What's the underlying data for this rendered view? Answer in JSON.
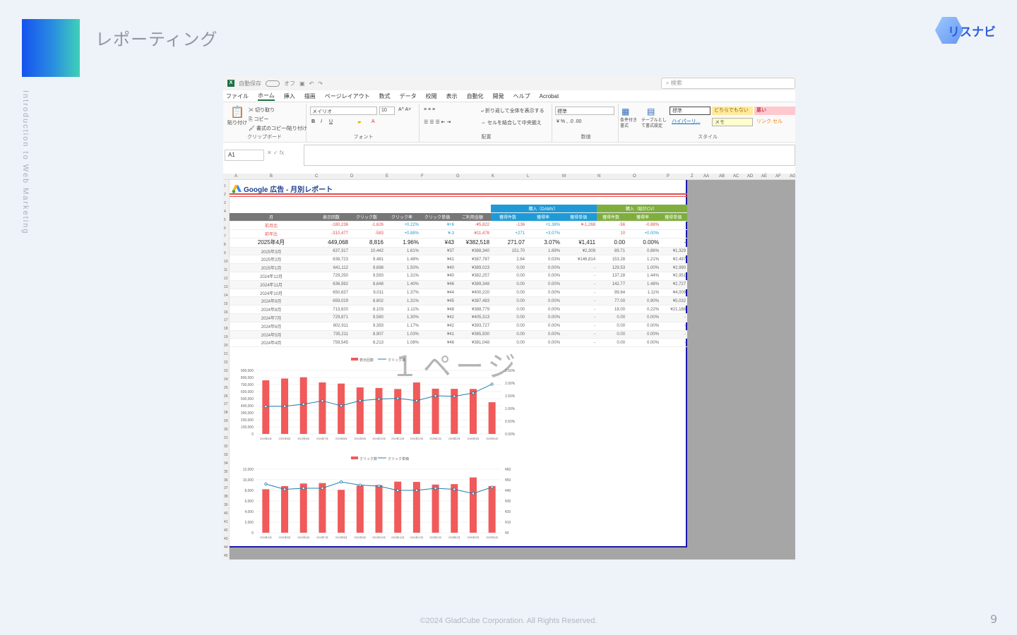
{
  "slide": {
    "title": "レポーティング",
    "side_text": "Introduction to Web Marketing",
    "logo_text": "リスナビ",
    "footer": "©2024 GladCube Corporation. All Rights Reserved.",
    "page_number": "9"
  },
  "excel": {
    "autosave_label": "自動保存",
    "autosave_state": "オフ",
    "search_placeholder": "検索",
    "menu": [
      "ファイル",
      "ホーム",
      "挿入",
      "描画",
      "ページレイアウト",
      "数式",
      "データ",
      "校閲",
      "表示",
      "自動化",
      "開発",
      "ヘルプ",
      "Acrobat"
    ],
    "ribbon": {
      "clipboard": {
        "label": "クリップボード",
        "paste": "貼り付け",
        "cut": "切り取り",
        "copy": "コピー",
        "format_painter": "書式のコピー/貼り付け"
      },
      "font": {
        "label": "フォント",
        "name": "メイリオ",
        "size": "10"
      },
      "alignment": {
        "label": "配置",
        "wrap": "折り返して全体を表示する",
        "merge": "セルを結合して中央揃え"
      },
      "number": {
        "label": "数値",
        "format": "標準"
      },
      "styles": {
        "label": "スタイル",
        "conditional": "条件付き書式",
        "table": "テーブルとして書式設定",
        "standard": "標準",
        "neutral": "どちらでもない",
        "bad": "悪い",
        "hyperlink": "ハイパーリ...",
        "memo": "メモ",
        "link_cell": "リンク セル"
      }
    },
    "name_box": "A1",
    "columns": [
      "A",
      "B",
      "C",
      "D",
      "E",
      "F",
      "G",
      "K",
      "L",
      "M",
      "N",
      "O",
      "P",
      "Z",
      "AA",
      "AB",
      "AC",
      "AD",
      "AE",
      "AF",
      "AG"
    ],
    "rows": [
      "1",
      "2",
      "3",
      "4",
      "5",
      "6",
      "7",
      "8",
      "9",
      "10",
      "11",
      "12",
      "13",
      "14",
      "15",
      "16",
      "17",
      "18",
      "19",
      "20",
      "21",
      "22",
      "23",
      "24",
      "25",
      "26",
      "27",
      "28",
      "29",
      "30",
      "31",
      "32",
      "33",
      "34",
      "35",
      "36",
      "37",
      "38",
      "39",
      "40",
      "41",
      "42",
      "43",
      "44",
      "45",
      "46",
      "47",
      "48",
      "49",
      "50"
    ],
    "watermark": "１ページ"
  },
  "report": {
    "title": "Google 広告 - 月別レポート",
    "group1": "購入（DAMV）",
    "group2": "購入（総計CV）",
    "headers": [
      "月",
      "表示回数",
      "クリック数",
      "クリック率",
      "クリック単価",
      "ご利用金額",
      "獲得件数",
      "獲得率",
      "獲得単価",
      "獲得件数",
      "獲得率",
      "獲得単価"
    ],
    "rows": [
      {
        "type": "sub",
        "cells": [
          "前月比",
          "-180,236",
          "-1,626",
          "+0.22%",
          "¥+6",
          "-¥5,822",
          "-136",
          "+1.38%",
          "¥-1,268",
          "-56",
          "-0.88%",
          ""
        ]
      },
      {
        "type": "sub",
        "cells": [
          "前年比",
          "-310,477",
          "-583",
          "+0.88%",
          "¥-3",
          "-¥11,478",
          "+271",
          "+3.07%",
          "",
          "10",
          "+0.00%",
          ""
        ]
      },
      {
        "type": "main",
        "cells": [
          "2025年4月",
          "449,068",
          "8,816",
          "1.96%",
          "¥43",
          "¥382,518",
          "271.07",
          "3.07%",
          "¥1,411",
          "0.00",
          "0.00%",
          "-"
        ]
      },
      {
        "type": "row",
        "cells": [
          "2025年3月",
          "637,317",
          "10,442",
          "1.61%",
          "¥37",
          "¥388,340",
          "151.70",
          "1.69%",
          "¥2,309",
          "89.71",
          "0.86%",
          "¥1,329"
        ]
      },
      {
        "type": "row",
        "cells": [
          "2025年2月",
          "638,723",
          "9,481",
          "1.48%",
          "¥41",
          "¥387,787",
          "2.64",
          "0.03%",
          "¥146,814",
          "153.28",
          "1.21%",
          "¥2,497"
        ]
      },
      {
        "type": "row",
        "cells": [
          "2025年1月",
          "641,112",
          "9,698",
          "1.50%",
          "¥40",
          "¥389,023",
          "0.00",
          "0.00%",
          "-",
          "129.53",
          "1.00%",
          "¥2,990"
        ]
      },
      {
        "type": "row",
        "cells": [
          "2024年12月",
          "729,250",
          "9,593",
          "1.31%",
          "¥40",
          "¥382,257",
          "0.00",
          "0.00%",
          "-",
          "137.28",
          "1.44%",
          "¥2,951"
        ]
      },
      {
        "type": "row",
        "cells": [
          "2024年11月",
          "636,592",
          "8,648",
          "1.40%",
          "¥46",
          "¥389,348",
          "0.00",
          "0.00%",
          "-",
          "142.77",
          "1.48%",
          "¥2,727"
        ]
      },
      {
        "type": "row",
        "cells": [
          "2024年10月",
          "650,637",
          "9,011",
          "1.37%",
          "¥44",
          "¥400,220",
          "0.00",
          "0.00%",
          "-",
          "99.84",
          "1.11%",
          "¥4,009"
        ]
      },
      {
        "type": "row",
        "cells": [
          "2024年9月",
          "659,029",
          "8,602",
          "1.31%",
          "¥45",
          "¥387,483",
          "0.00",
          "0.00%",
          "-",
          "77.00",
          "0.90%",
          "¥5,032"
        ]
      },
      {
        "type": "row",
        "cells": [
          "2024年8月",
          "713,620",
          "8,103",
          "1.11%",
          "¥48",
          "¥388,779",
          "0.00",
          "0.00%",
          "-",
          "18.00",
          "0.22%",
          "¥21,188"
        ]
      },
      {
        "type": "row",
        "cells": [
          "2024年7月",
          "729,871",
          "9,580",
          "1.30%",
          "¥42",
          "¥405,313",
          "0.00",
          "0.00%",
          "-",
          "0.00",
          "0.00%",
          "-"
        ]
      },
      {
        "type": "row",
        "cells": [
          "2024年6月",
          "802,911",
          "9,393",
          "1.17%",
          "¥42",
          "¥393,727",
          "0.00",
          "0.00%",
          "-",
          "0.00",
          "0.00%",
          "-"
        ]
      },
      {
        "type": "row",
        "cells": [
          "2024年5月",
          "735,211",
          "8,907",
          "1.03%",
          "¥41",
          "¥365,930",
          "0.00",
          "0.00%",
          "-",
          "0.00",
          "0.00%",
          "-"
        ]
      },
      {
        "type": "row",
        "cells": [
          "2024年4月",
          "759,545",
          "8,213",
          "1.08%",
          "¥46",
          "¥381,048",
          "0.00",
          "0.00%",
          "-",
          "0.00",
          "0.00%",
          "-"
        ]
      }
    ]
  },
  "chart_data": [
    {
      "type": "bar",
      "categories": [
        "2024年4月",
        "2024年5月",
        "2024年6月",
        "2024年7月",
        "2024年8月",
        "2024年9月",
        "2024年10月",
        "2024年11月",
        "2024年12月",
        "2025年1月",
        "2025年2月",
        "2025年3月",
        "2025年4月"
      ],
      "series": [
        {
          "name": "表示回数",
          "values": [
            759545,
            785211,
            802911,
            729871,
            713620,
            659029,
            650637,
            636592,
            729250,
            641112,
            638723,
            637317,
            449068
          ],
          "color": "#f05a5a"
        },
        {
          "name": "クリック率",
          "type": "line",
          "axis": "right",
          "values": [
            1.08,
            1.09,
            1.17,
            1.3,
            1.11,
            1.31,
            1.37,
            1.4,
            1.31,
            1.5,
            1.48,
            1.61,
            1.96
          ],
          "color": "#1f7fa8"
        }
      ],
      "ylim": [
        0,
        900000
      ],
      "y_ticks": [
        "900,000",
        "800,000",
        "700,000",
        "600,000",
        "500,000",
        "400,000",
        "300,000",
        "200,000",
        "100,000",
        "0"
      ],
      "y2_ticks": [
        "2.50%",
        "2.00%",
        "1.50%",
        "1.00%",
        "0.50%",
        "0.00%"
      ],
      "y2lim": [
        0,
        2.5
      ],
      "legend": "top-center"
    },
    {
      "type": "bar",
      "categories": [
        "2024年4月",
        "2024年5月",
        "2024年6月",
        "2024年7月",
        "2024年8月",
        "2024年9月",
        "2024年10月",
        "2024年11月",
        "2024年12月",
        "2025年1月",
        "2025年2月",
        "2025年3月",
        "2025年4月"
      ],
      "series": [
        {
          "name": "クリック数",
          "values": [
            8213,
            8807,
            9293,
            9380,
            8103,
            8902,
            9011,
            9648,
            9593,
            9098,
            9181,
            10442,
            8816
          ],
          "color": "#f05a5a"
        },
        {
          "name": "クリック単価",
          "type": "line",
          "axis": "right",
          "values": [
            46,
            41,
            42,
            42,
            48,
            45,
            44,
            40,
            40,
            42,
            41,
            37,
            43
          ],
          "color": "#1f7fa8"
        }
      ],
      "ylim": [
        0,
        12000
      ],
      "y_ticks": [
        "12,000",
        "10,000",
        "8,000",
        "6,000",
        "4,000",
        "2,000",
        "0"
      ],
      "y2_ticks": [
        "¥60",
        "¥50",
        "¥40",
        "¥30",
        "¥20",
        "¥10",
        "¥0"
      ],
      "y2lim": [
        0,
        60
      ],
      "legend": "top-center"
    }
  ]
}
